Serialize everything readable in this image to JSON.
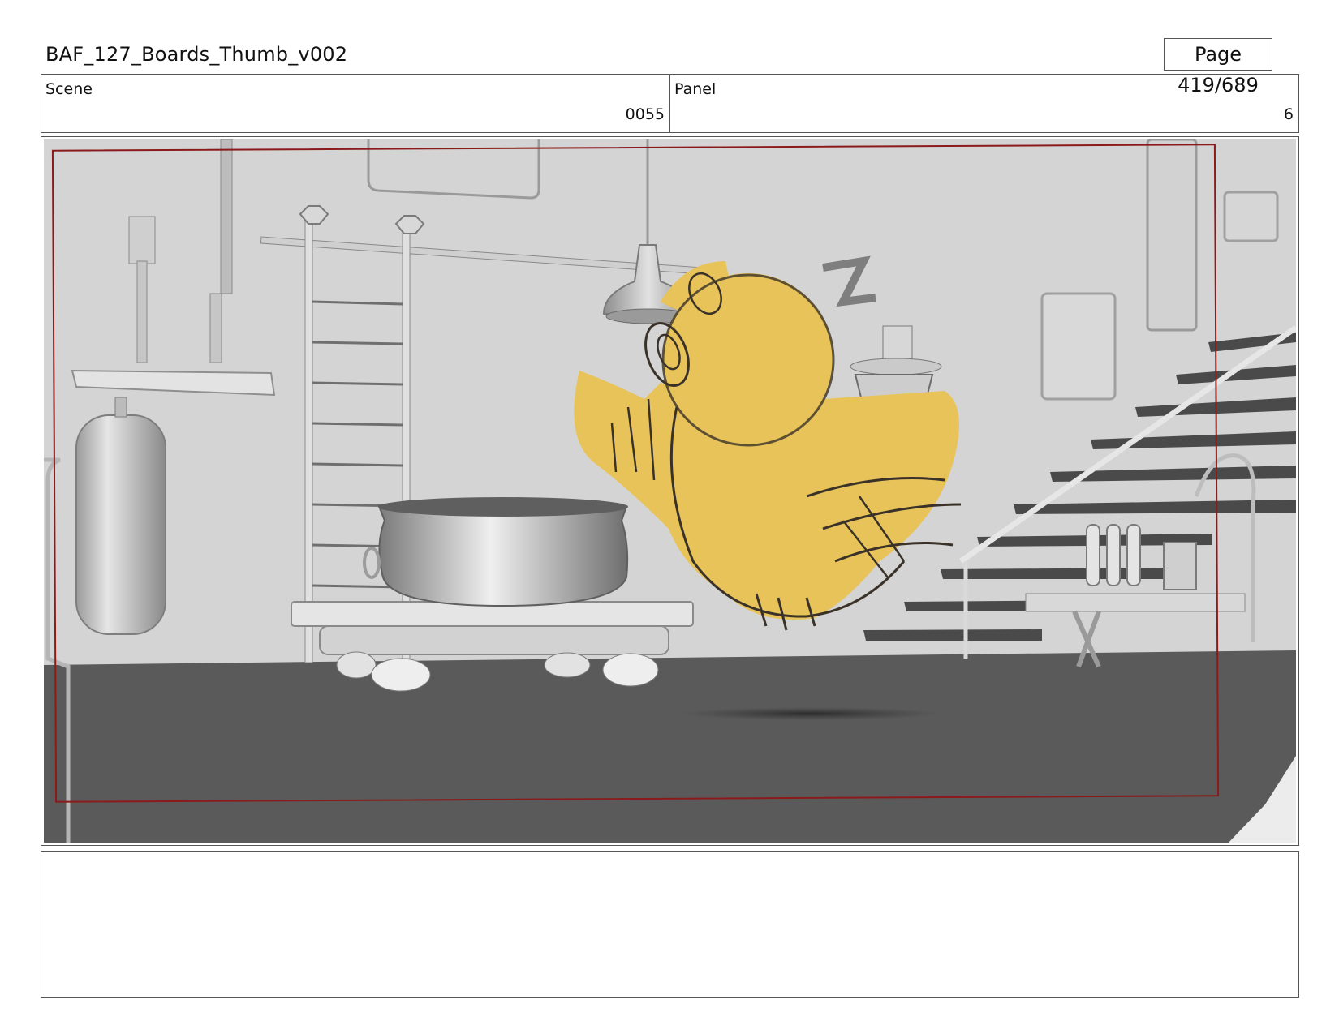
{
  "document": {
    "title": "BAF_127_Boards_Thumb_v002",
    "page_label": "Page 419/689"
  },
  "info": {
    "scene_label": "Scene",
    "scene_value": "0055",
    "panel_label": "Panel",
    "panel_value": "6"
  },
  "colors": {
    "safe_frame": "#8b1a1a",
    "character_fill": "#e8c35a",
    "floor": "#5a5a5a",
    "wall": "#d4d4d4"
  },
  "notes": {
    "text": ""
  }
}
